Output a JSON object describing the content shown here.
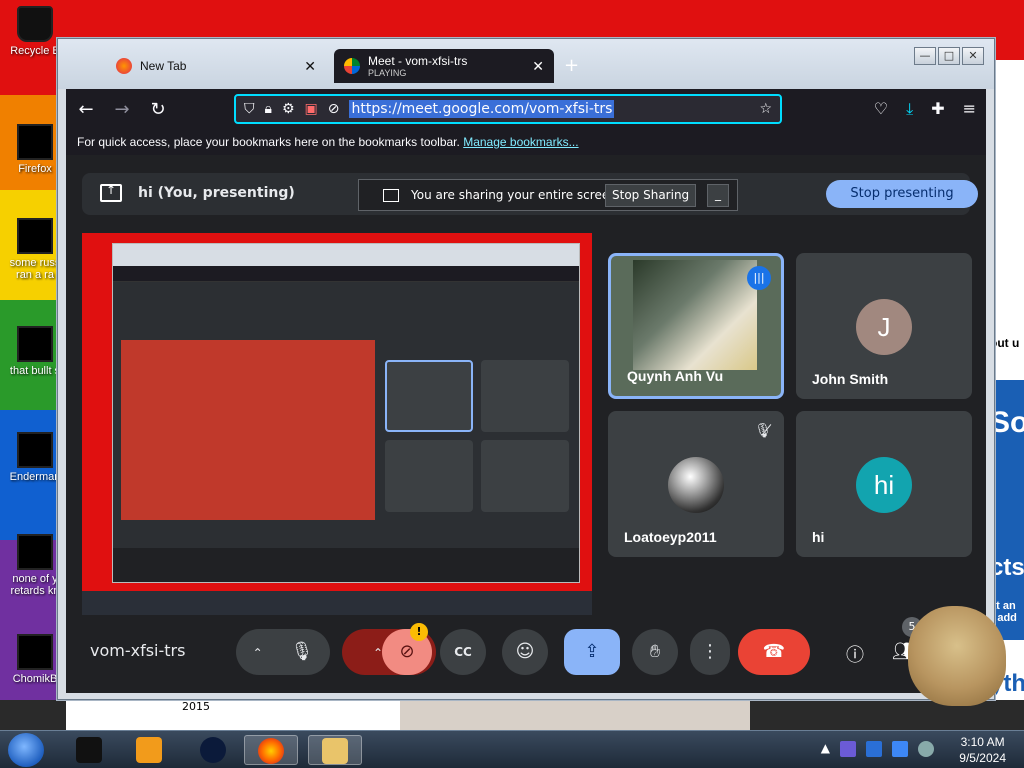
{
  "desktop": {
    "icons": [
      {
        "label": "Recycle B"
      },
      {
        "label": "Firefox"
      },
      {
        "label": "some russ\nran a ra"
      },
      {
        "label": "that bullt s"
      },
      {
        "label": "Enderman"
      },
      {
        "label": "none of y\nretards kn"
      },
      {
        "label": "ChomikB"
      }
    ],
    "bottom_number": "2015",
    "right_fragments": [
      "out u",
      "So",
      "cts",
      "at an\nr add",
      "yth"
    ]
  },
  "browser": {
    "tabs": [
      {
        "title": "New Tab",
        "status": ""
      },
      {
        "title": "Meet - vom-xfsi-trs",
        "status": "PLAYING"
      }
    ],
    "url": "https://meet.google.com/vom-xfsi-trs",
    "bookmarks_hint": "For quick access, place your bookmarks here on the bookmarks toolbar.",
    "manage_bookmarks": "Manage bookmarks..."
  },
  "meet": {
    "presenting_label": "hi (You, presenting)",
    "sharing_text": "You are sharing your entire screen.",
    "stop_sharing": "Stop Sharing",
    "stop_presenting": "Stop presenting",
    "meeting_code": "vom-xfsi-trs",
    "participants": [
      {
        "name": "Quynh Anh Vu",
        "avatar": ""
      },
      {
        "name": "John Smith",
        "avatar": "J"
      },
      {
        "name": "Loatoeyp2011",
        "avatar": ""
      },
      {
        "name": "hi",
        "avatar": "hi"
      }
    ],
    "people_count": "5",
    "warning_badge": "!"
  },
  "taskbar": {
    "time": "3:10 AM",
    "date": "9/5/2024"
  },
  "colors": {
    "meet_bg": "#202124",
    "accent_blue": "#8ab4f8",
    "end_call_red": "#ea4335",
    "url_focus": "#00ddff"
  }
}
